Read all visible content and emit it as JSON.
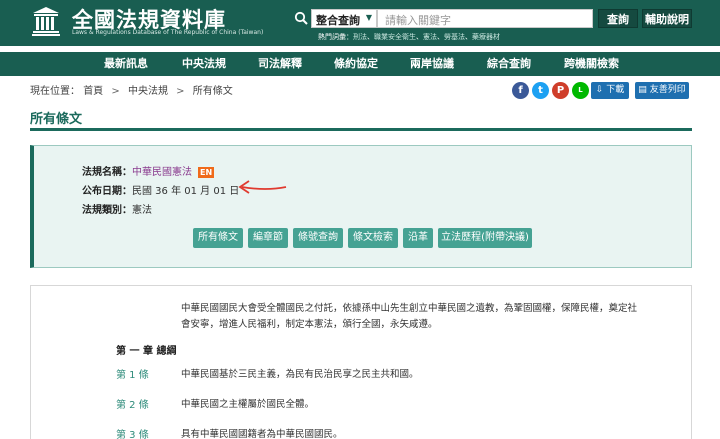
{
  "header": {
    "site_title": "全國法規資料庫",
    "site_subtitle": "Laws & Regulations Database of The Republic of China (Taiwan)",
    "search_type": "整合查詢",
    "search_placeholder": "請輸入關鍵字",
    "search_button": "查詢",
    "help_button": "輔助說明",
    "hot_label": "熱門詞彙：",
    "hot_items": [
      "刑法",
      "職業安全衛生",
      "憲法",
      "勞基法",
      "藥療器材"
    ],
    "hot_sep": "、"
  },
  "nav": {
    "items": [
      "最新訊息",
      "中央法規",
      "司法解釋",
      "條約協定",
      "兩岸協議",
      "綜合查詢",
      "跨機關檢索"
    ]
  },
  "breadcrumb": {
    "prefix": "現在位置：",
    "items": [
      "首頁",
      "中央法規",
      "所有條文"
    ],
    "sep": ">"
  },
  "toolbar": {
    "share": [
      {
        "icon": "facebook-icon",
        "glyph": "f",
        "color": "#3b5998"
      },
      {
        "icon": "twitter-icon",
        "glyph": "t",
        "color": "#1da1f2"
      },
      {
        "icon": "plurk-icon",
        "glyph": "P",
        "color": "#cf3e2a"
      },
      {
        "icon": "line-icon",
        "glyph": "L",
        "color": "#00b900"
      }
    ],
    "download_label": "下載",
    "print_label": "友善列印"
  },
  "page": {
    "section_title": "所有條文"
  },
  "law_info": {
    "name_label": "法規名稱：",
    "name_value": "中華民國憲法",
    "en_badge": "EN",
    "date_label": "公布日期：",
    "date_value": "民國 36 年 01 月 01 日",
    "category_label": "法規類別：",
    "category_value": "憲法"
  },
  "tabs": [
    "所有條文",
    "編章節",
    "條號查詢",
    "條文檢索",
    "沿革",
    "立法歷程(附帶決議)"
  ],
  "content": {
    "preamble_line1": "中華民國國民大會受全體國民之付託，依據孫中山先生創立中華民國之遺教，為鞏固國權，保障民權，奠定社",
    "preamble_line2": "會安寧，增進人民福利，制定本憲法，頒行全國，永矢咸遵。",
    "chapter": "第 一 章 總綱",
    "articles": [
      {
        "no": "第 1 條",
        "text": "中華民國基於三民主義，為民有民治民享之民主共和國。"
      },
      {
        "no": "第 2 條",
        "text": "中華民國之主權屬於國民全體。"
      },
      {
        "no": "第 3 條",
        "text": "具有中華民國國籍者為中華民國國民。"
      }
    ]
  },
  "colors": {
    "header_bg": "#195e51",
    "accent": "#1b6a5c",
    "tab_bg": "#45a293",
    "button_blue": "#1e6fb0",
    "annotation_red": "#e03a2f"
  }
}
